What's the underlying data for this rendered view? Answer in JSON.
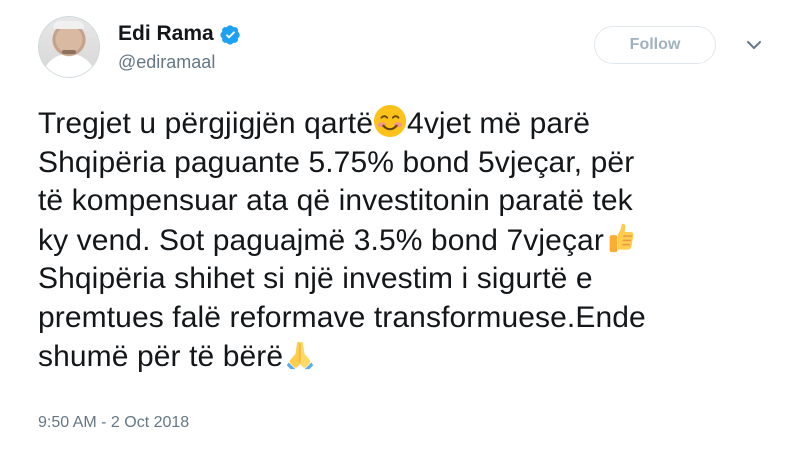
{
  "user": {
    "display_name": "Edi Rama",
    "handle": "@ediramaal",
    "verified": true
  },
  "actions": {
    "follow_label": "Follow"
  },
  "tweet": {
    "lines": [
      {
        "parts": [
          "Tregjet u përgjigjën qartë",
          "4vjet më parë"
        ]
      },
      {
        "text": "Shqipëria paguante 5.75% bond 5vjeçar, për"
      },
      {
        "text": "të kompensuar ata që investitonin paratë tek"
      },
      {
        "text": "ky vend. Sot paguajmë 3.5% bond 7vjeçar"
      },
      {
        "text": "Shqipëria shihet si një investim i sigurtë e"
      },
      {
        "text": "premtues falë reformave transformuese.Ende"
      },
      {
        "text": "shumë për të bërë"
      }
    ],
    "emojis": [
      "smiling-face-icon",
      "thumbs-up-icon",
      "folded-hands-icon"
    ]
  },
  "meta": {
    "timestamp": "9:50 AM - 2 Oct 2018"
  },
  "colors": {
    "text": "#14171a",
    "secondary": "#657786",
    "verified": "#1da1f2",
    "button_text": "#9fb2c2",
    "button_border": "#e1e8ed",
    "emoji_yellow": "#fcc21b"
  }
}
